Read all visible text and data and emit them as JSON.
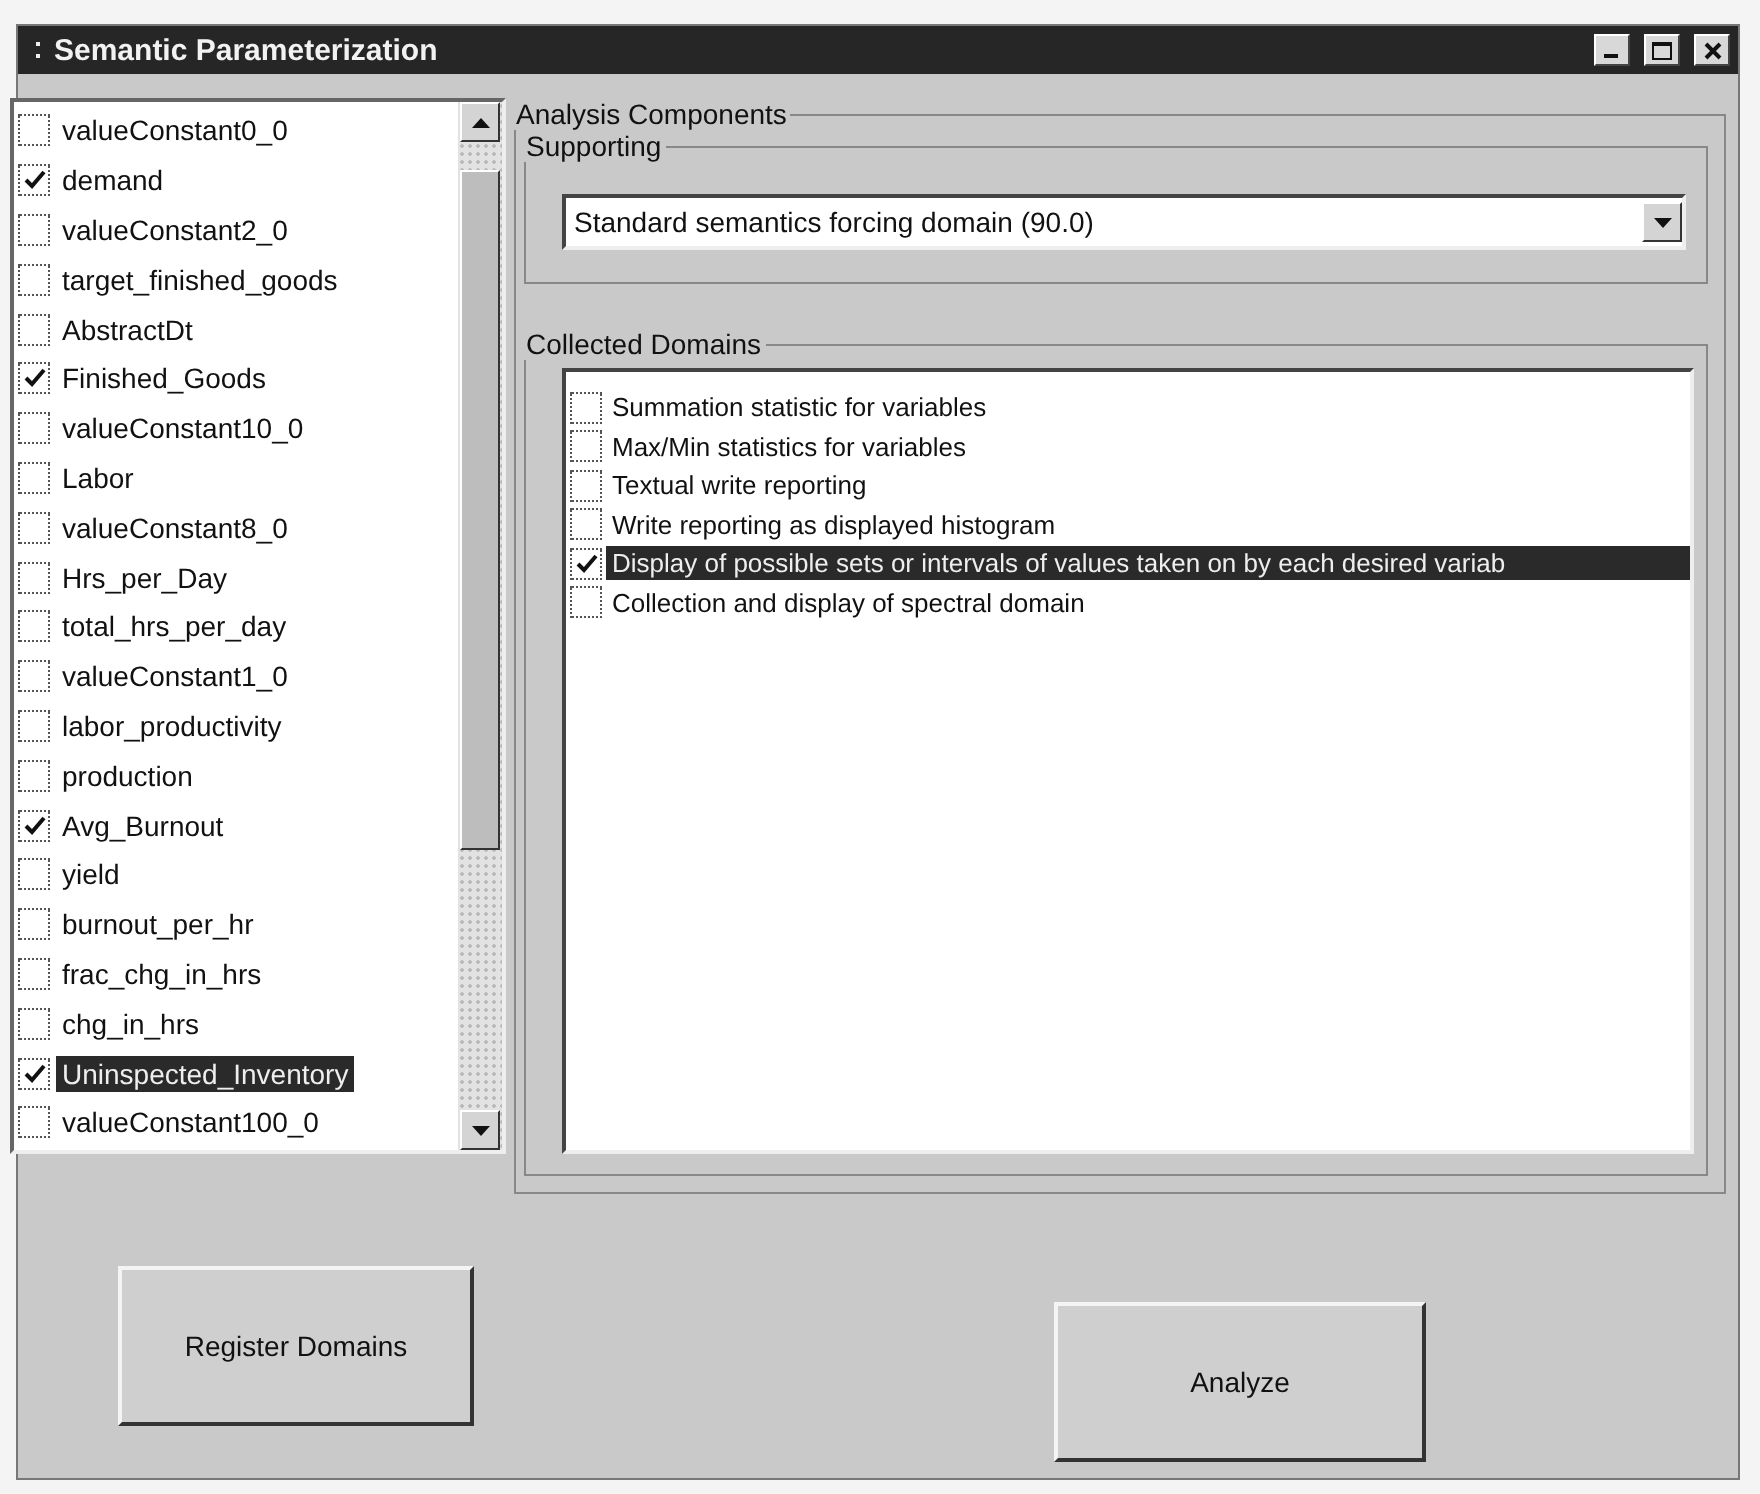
{
  "window": {
    "title": "Semantic Parameterization"
  },
  "variables": [
    {
      "label": "valueConstant0_0",
      "checked": false,
      "selected": false
    },
    {
      "label": "demand",
      "checked": true,
      "selected": false
    },
    {
      "label": "valueConstant2_0",
      "checked": false,
      "selected": false
    },
    {
      "label": "target_finished_goods",
      "checked": false,
      "selected": false
    },
    {
      "label": "AbstractDt",
      "checked": false,
      "selected": false
    },
    {
      "label": "Finished_Goods",
      "checked": true,
      "selected": false
    },
    {
      "label": "valueConstant10_0",
      "checked": false,
      "selected": false
    },
    {
      "label": "Labor",
      "checked": false,
      "selected": false
    },
    {
      "label": "valueConstant8_0",
      "checked": false,
      "selected": false
    },
    {
      "label": "Hrs_per_Day",
      "checked": false,
      "selected": false
    },
    {
      "label": "total_hrs_per_day",
      "checked": false,
      "selected": false
    },
    {
      "label": "valueConstant1_0",
      "checked": false,
      "selected": false
    },
    {
      "label": "labor_productivity",
      "checked": false,
      "selected": false
    },
    {
      "label": "production",
      "checked": false,
      "selected": false
    },
    {
      "label": "Avg_Burnout",
      "checked": true,
      "selected": false
    },
    {
      "label": "yield",
      "checked": false,
      "selected": false
    },
    {
      "label": "burnout_per_hr",
      "checked": false,
      "selected": false
    },
    {
      "label": "frac_chg_in_hrs",
      "checked": false,
      "selected": false
    },
    {
      "label": "chg_in_hrs",
      "checked": false,
      "selected": false
    },
    {
      "label": "Uninspected_Inventory",
      "checked": true,
      "selected": true
    },
    {
      "label": "valueConstant100_0",
      "checked": false,
      "selected": false
    }
  ],
  "analysis_components": {
    "title": "Analysis Components",
    "supporting": {
      "title": "Supporting",
      "value": "Standard semantics forcing domain (90.0)"
    },
    "collected_domains": {
      "title": "Collected Domains",
      "items": [
        {
          "label": "Summation statistic for variables",
          "checked": false,
          "selected": false
        },
        {
          "label": "Max/Min statistics for variables",
          "checked": false,
          "selected": false
        },
        {
          "label": "Textual write reporting",
          "checked": false,
          "selected": false
        },
        {
          "label": "Write reporting as displayed histogram",
          "checked": false,
          "selected": false
        },
        {
          "label": "Display of possible sets or intervals of values taken on by each desired variab",
          "checked": true,
          "selected": true
        },
        {
          "label": "Collection and display of spectral domain",
          "checked": false,
          "selected": false
        }
      ]
    }
  },
  "buttons": [
    {
      "label": "Register Domains"
    },
    {
      "label": "Analyze"
    }
  ]
}
